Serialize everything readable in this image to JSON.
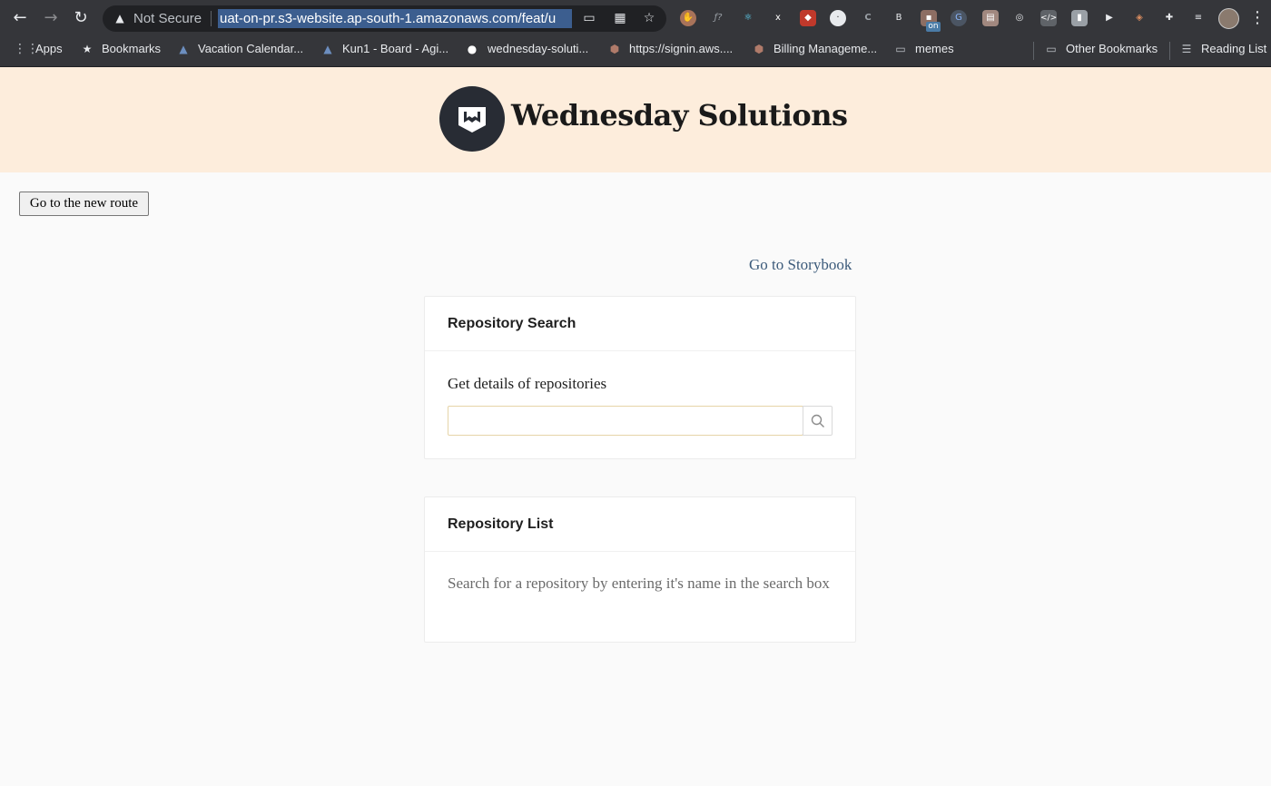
{
  "browser": {
    "security_label": "Not Secure",
    "url": "uat-on-pr.s3-website.ap-south-1.amazonaws.com/feat/u",
    "bookmarks": [
      {
        "label": "Apps"
      },
      {
        "label": "Bookmarks"
      },
      {
        "label": "Vacation Calendar..."
      },
      {
        "label": "Kun1 - Board - Agi..."
      },
      {
        "label": "wednesday-soluti..."
      },
      {
        "label": "https://signin.aws...."
      },
      {
        "label": "Billing Manageme..."
      },
      {
        "label": "memes"
      }
    ],
    "other_bookmarks": "Other Bookmarks",
    "reading_list": "Reading List",
    "extension_badge": "on"
  },
  "header": {
    "brand": "Wednesday Solutions"
  },
  "route_button": "Go to the new route",
  "storybook_link": "Go to Storybook",
  "search_card": {
    "title": "Repository Search",
    "label": "Get details of repositories",
    "input_value": ""
  },
  "list_card": {
    "title": "Repository List",
    "empty_message": "Search for a repository by entering it's name in the search box"
  },
  "colors": {
    "header_bg": "#fdeddc",
    "chrome_bg": "#35363a",
    "link": "#3b5a7a"
  }
}
